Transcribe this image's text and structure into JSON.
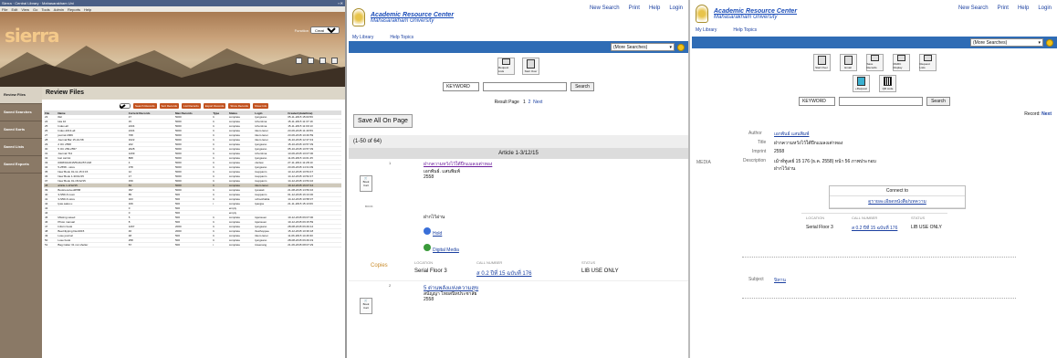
{
  "sierra": {
    "title": "Sierra · Central Library · Mahasarakham Uni",
    "menu": [
      "File",
      "Edit",
      "View",
      "Go",
      "Tools",
      "Admin",
      "Reports",
      "Help"
    ],
    "logo": "sierra",
    "function_label": "Function",
    "function_value": "Create Lists",
    "sidebar": [
      "Review Files",
      "Saved Searches",
      "Saved Sorts",
      "Saved Lists",
      "Saved Exports"
    ],
    "header": "Review Files",
    "count_value": "All",
    "buttons": [
      "Search Records",
      "Sort Records",
      "List Records",
      "Export Records",
      "Show Records",
      "Show Info"
    ],
    "columns": [
      "File",
      "Name",
      "Current Records",
      "Max Records",
      "Type",
      "Status",
      "Login",
      "Created (date/time)"
    ],
    "rows": [
      [
        "23",
        "lbkl",
        "47",
        "5000",
        "b",
        "complete",
        "tjungsano",
        "05-11-2015 15:00:56"
      ],
      [
        "24",
        "lula 10",
        "15",
        "5000",
        "b",
        "complete",
        "tchontima",
        "15-11-2015 11:37:19"
      ],
      [
        "25",
        "Index-all",
        "2434",
        "5000",
        "b",
        "complete",
        "tchontima",
        "15-11-2015 11:00:13"
      ],
      [
        "26",
        "Index-2013-all",
        "2434",
        "5000",
        "b",
        "complete",
        "tikom.lanoi",
        "23-06-2015 11:49:59"
      ],
      [
        "27",
        "journal 2009",
        "768",
        "5000",
        "b",
        "complete",
        "tikom.lanoi",
        "23-06-2015 10:40:59"
      ],
      [
        "28",
        "Journal Bar 15-10-58",
        "1022",
        "5000",
        "b",
        "complete",
        "tikom.lanoi",
        "16-10-2015 12:37:43"
      ],
      [
        "29",
        "2 OC 2558",
        "222",
        "5000",
        "b",
        "complete",
        "tjungsano",
        "15-10-2015 10:57:39"
      ],
      [
        "30",
        "5 OC 256-2557",
        "2028",
        "5000",
        "b",
        "complete",
        "tjungsano",
        "05-10-2015 10:57:39"
      ],
      [
        "31",
        "Journal ?44",
        "1209",
        "5000",
        "b",
        "complete",
        "tchontima",
        "13-06-2015 10:07:00"
      ],
      [
        "32",
        "lost cat list",
        "868",
        "5000",
        "b",
        "complete",
        "tjungsano",
        "11-06-2015 14:01:45"
      ],
      [
        "33",
        "0308/01/2015/5/24/2571/18",
        "4",
        "5000",
        "b",
        "complete",
        "clerlew",
        "27-11-2014 11:28:10"
      ],
      [
        "34",
        "5-2558 - store",
        "378",
        "5000",
        "b",
        "complete",
        "tjungsano",
        "23-06-2015 14:31:09"
      ],
      [
        "35",
        "New Book 01-11-15 0:15",
        "12",
        "5000",
        "b",
        "complete",
        "tsuppanm",
        "13-12-2015 10:53:47"
      ],
      [
        "36",
        "New Book 1-30/11/15",
        "17",
        "5000",
        "b",
        "complete",
        "tsuppanm",
        "14-12-2015 10:52:47"
      ],
      [
        "37",
        "New Book 01-15/12/15",
        "159",
        "5000",
        "b",
        "complete",
        "tsuppanm",
        "14-12-2015 13:53:16"
      ],
      [
        "38",
        "article 1-3/12/15",
        "84",
        "5000",
        "b",
        "complete",
        "tikom.lanoi",
        "10-12-2015 16:07:44"
      ],
      [
        "39",
        "Bookreceived2558",
        "397",
        "5000",
        "b",
        "complete",
        "tjuvaiait",
        "21-08-2015 13:59:16"
      ],
      [
        "40",
        "3-S5D-6 room",
        "85",
        "500",
        "b",
        "complete",
        "tsuppanm",
        "01-12-2015 16:13:30"
      ],
      [
        "41",
        "3-S5D-6 store",
        "323",
        "500",
        "b",
        "complete",
        "schoothalita",
        "14-12-2015 10:58:37"
      ],
      [
        "42",
        "Ipas.sales.u",
        "169",
        "500",
        "i",
        "complete",
        "lpanjpa",
        "21-11-2015 15:13:06"
      ],
      [
        "43",
        "",
        "0",
        "500",
        "",
        "empty",
        "",
        ""
      ],
      [
        "44",
        "",
        "0",
        "500",
        "",
        "empty",
        "",
        ""
      ],
      [
        "45",
        "Missing saved",
        "5",
        "500",
        "b",
        "complete",
        "tsjansoen",
        "10-12-2015 09:07:00"
      ],
      [
        "46",
        "Photo manual",
        "8",
        "500",
        "b",
        "complete",
        "tsjansoen",
        "10-12-2015 09:15:59"
      ],
      [
        "47",
        "Inform book",
        "1297",
        "2000",
        "b",
        "complete",
        "tjungsano",
        "28-08-2015 09:49:12"
      ],
      [
        "48",
        "BeeClipping Dec2015",
        "46",
        "2000",
        "b",
        "complete",
        "tfesthoppee",
        "15-12-2015 10:36:18"
      ],
      [
        "49",
        "Lose journal",
        "48",
        "500",
        "b",
        "complete",
        "tikom.lanoi",
        "11-06-2015 14:46:30"
      ],
      [
        "50",
        "Lose book",
        "258",
        "500",
        "b",
        "complete",
        "tjungsano",
        "28-08-2015 09:49:19"
      ],
      [
        "51",
        "Bag Calier 31 not shelter",
        "57",
        "500",
        "i",
        "complete",
        "tswenang",
        "21-06-2015 08:07:29"
      ]
    ]
  },
  "opac": {
    "brand_title": "Academic Resource Center",
    "brand_sub": "Mahasarakham University",
    "top_links": [
      "New Search",
      "Print",
      "Help",
      "Login"
    ],
    "sub_links": [
      "My Library",
      "Help Topics"
    ],
    "searches_select": "(More Searches)",
    "tools_p2": [
      "Request Lists",
      "Start Over"
    ],
    "keyword": "KEYWORD",
    "search_btn": "Search",
    "result_page": "Result Page",
    "pages": [
      "1",
      "2"
    ],
    "next": "Next",
    "save_all": "Save All On Page",
    "range": "(1-50 of 64)",
    "article_bar": "Article 1-3/12/15",
    "rec1": {
      "num": "1",
      "cart": "Book Cart",
      "book": "BOOK",
      "title": "ฝากความหวังไว้ใต้ปีกแมลงเต่าทอง",
      "author": "เอกพันธ์. แสนพิมพ์",
      "year": "2558",
      "thai": "ฝากไว้อ่าน",
      "hold": "Hold",
      "digital": "Digital Media",
      "copies": "Copies",
      "h_loc": "LOCATION",
      "h_call": "CALL NUMBER",
      "h_status": "STATUS",
      "loc": "Serial Floor 3",
      "call": "ส 0.2 ปีที่ 15 ฉบับที่ 176",
      "status": "LIB USE ONLY"
    },
    "rec2": {
      "num": "2",
      "title": "5 ด่านพลังแห่งความสุข",
      "author": "สนัญญา ไทยสนิทประชาสัย",
      "year": "2558"
    },
    "tools_p3": [
      "Start Over",
      "Email",
      "Save Records",
      "MARC Display",
      "Request Lists"
    ],
    "tools_p3b": [
      "+Request",
      "QR code"
    ],
    "record_label": "Record:",
    "record_next": "Next",
    "detail": {
      "author_lbl": "Author",
      "author": "เอกพันธ์ แสนพิมพ์",
      "title_lbl": "Title",
      "title": "ฝากความหวังไว้ใต้ปีกแมลงเต่าทอง",
      "imprint_lbl": "Imprint",
      "imprint": "2558",
      "desc_lbl": "Description",
      "desc": "เม้าท์ทูเดย์ 15 176 (ธ.ค. 2558) หน้า 56 ภาพประกอบ",
      "desc2": "ฝากไว้อ่าน",
      "media": "MEDIA",
      "connect": "Connect to",
      "connect_link": "ดูรายละเอียดหนังสือ/บทความ",
      "h_loc": "LOCATION",
      "h_call": "CALL NUMBER",
      "h_status": "STATUS",
      "loc": "Serial Floor 3",
      "call": "ส 0.2 ปีที่ 15 ฉบับที่ 176",
      "status": "LIB USE ONLY",
      "subject_lbl": "Subject",
      "subject": "นิทาน"
    }
  }
}
